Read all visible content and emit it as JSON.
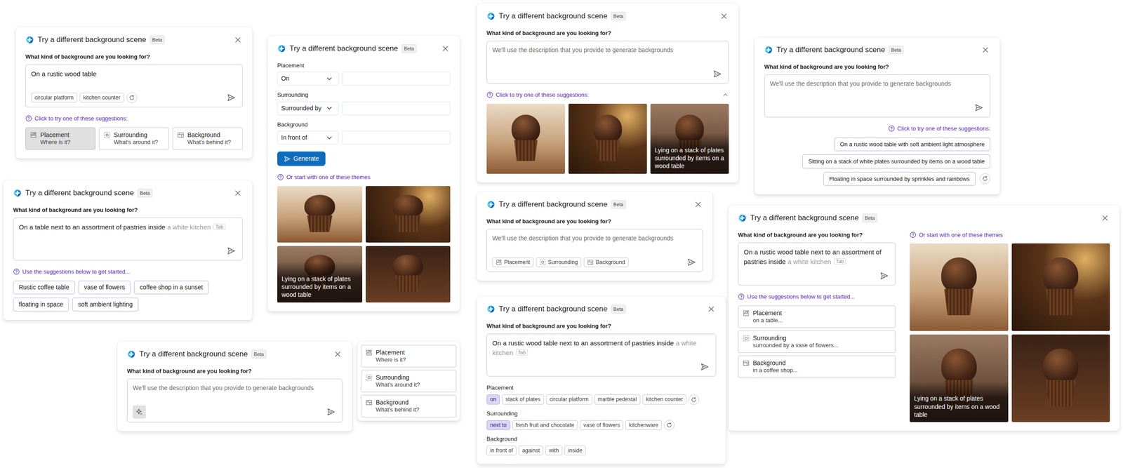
{
  "panels": [
    {
      "kind": "dialog",
      "title": "Try a different background scene",
      "badge": "Beta",
      "question": "What kind of background are you looking for?",
      "columns": [
        [
          {
            "kind": "input",
            "value": "On a rustic wood table",
            "chips": [
              {
                "kind": "chip",
                "label": "circular platform"
              },
              {
                "kind": "chip",
                "label": "kitchen counter"
              },
              {
                "kind": "refresh"
              }
            ]
          },
          {
            "kind": "hint",
            "text": "Click to try one of these suggestions:"
          },
          {
            "kind": "cards",
            "items": [
              {
                "label": "Placement",
                "sub": "Where is it?",
                "selected": true
              },
              {
                "label": "Surrounding",
                "sub": "What's around it?",
                "selected": false
              },
              {
                "label": "Background",
                "sub": "What's behind it?",
                "selected": false
              }
            ]
          }
        ]
      ]
    },
    {
      "kind": "dialog",
      "title": "Try a different background scene",
      "badge": "Beta",
      "columns": [
        [
          {
            "kind": "fields",
            "items": [
              {
                "label": "Placement",
                "select": "On"
              },
              {
                "label": "Surrounding",
                "select": "Surrounded by"
              },
              {
                "label": "Background",
                "select": "In front of"
              }
            ]
          },
          {
            "kind": "button",
            "label": "Generate"
          },
          {
            "kind": "hint",
            "text": "Or start with one of these themes"
          },
          {
            "kind": "grid",
            "items": [
              {},
              {},
              {
                "caption": "Lying on a stack of plates surrounded by items on a wood table"
              },
              {}
            ]
          }
        ]
      ]
    },
    {
      "kind": "dialog",
      "title": "Try a different background scene",
      "badge": "Beta",
      "question": "What kind of background are you looking for?",
      "columns": [
        [
          {
            "kind": "input",
            "placeholder": "We'll use the description that you provide to generate backgrounds"
          },
          {
            "kind": "hint",
            "text": "Click to try one of these suggestions:",
            "expanded": true
          },
          {
            "kind": "row",
            "items": [
              {},
              {},
              {
                "caption": "Lying on a stack of plates surrounded by items on a wood table"
              }
            ]
          }
        ]
      ]
    },
    {
      "kind": "dialog",
      "title": "Try a different background scene",
      "badge": "Beta",
      "question": "What kind of background are you looking for?",
      "columns": [
        [
          {
            "kind": "input",
            "placeholder": "We'll use the description that you provide to generate backgrounds"
          },
          {
            "kind": "hint-end",
            "text": "Click to try one of these suggestions:"
          },
          {
            "kind": "suggestions",
            "items": [
              {
                "kind": "chip",
                "label": "On a rustic wood table with soft ambient light atmosphere"
              },
              {
                "kind": "chip",
                "label": "Sitting on a stack of white plates surrounded by items on a wood table"
              },
              {
                "kind": "chip",
                "label": "Floating in space surrounded by sprinkles and rainbows"
              },
              {
                "kind": "refresh"
              }
            ]
          }
        ]
      ]
    },
    {
      "kind": "dialog",
      "title": "Try a different background scene",
      "badge": "Beta",
      "question": "What kind of background are you looking for?",
      "columns": [
        [
          {
            "kind": "input",
            "value": "On a table next to an assortment of pastries inside",
            "ghost": "a white kitchen",
            "key": "Tab"
          },
          {
            "kind": "hint",
            "text": "Use the suggestions below to get started..."
          },
          {
            "kind": "chips",
            "items": [
              {
                "kind": "chip",
                "label": "Rustic coffee table"
              },
              {
                "kind": "chip",
                "label": "vase of flowers"
              },
              {
                "kind": "chip",
                "label": "coffee shop in a sunset"
              },
              {
                "kind": "chip",
                "label": "floating in space"
              },
              {
                "kind": "chip",
                "label": "soft ambient lighting"
              }
            ]
          }
        ]
      ]
    },
    {
      "kind": "dialog",
      "title": "Try a different background scene",
      "badge": "Beta",
      "question": "What kind of background are you looking for?",
      "columns": [
        [
          {
            "kind": "input",
            "placeholder": "We'll use the description that you provide to generate backgrounds",
            "chips": [
              {
                "kind": "icon-chip",
                "label": "Placement"
              },
              {
                "kind": "icon-chip",
                "label": "Surrounding"
              },
              {
                "kind": "icon-chip",
                "label": "Background"
              }
            ]
          }
        ]
      ]
    },
    {
      "kind": "dialog",
      "title": "Try a different background scene",
      "badge": "Beta",
      "question": "What kind of background are you looking for?",
      "columns": [
        [
          {
            "kind": "input",
            "value": "On a rustic wood table next to an assortment of pastries inside",
            "ghost": "a white kitchen",
            "key": "Tab"
          },
          {
            "kind": "groups",
            "items": [
              {
                "label": "Placement",
                "chips": [
                  {
                    "kind": "chip",
                    "label": "on",
                    "selected": true
                  },
                  {
                    "kind": "chip",
                    "label": "stack of plates",
                    "selected": false
                  },
                  {
                    "kind": "chip",
                    "label": "circular platform",
                    "selected": false
                  },
                  {
                    "kind": "chip",
                    "label": "marble pedestal",
                    "selected": false
                  },
                  {
                    "kind": "chip",
                    "label": "kitchen counter",
                    "selected": false
                  },
                  {
                    "kind": "refresh"
                  }
                ]
              },
              {
                "label": "Surrounding",
                "chips": [
                  {
                    "kind": "chip",
                    "label": "next to",
                    "selected": true
                  },
                  {
                    "kind": "chip",
                    "label": "fresh fruit and chocolate",
                    "selected": false
                  },
                  {
                    "kind": "chip",
                    "label": "vase of flowers",
                    "selected": false
                  },
                  {
                    "kind": "chip",
                    "label": "kitchenware",
                    "selected": false
                  },
                  {
                    "kind": "refresh"
                  }
                ]
              },
              {
                "label": "Background",
                "chips": [
                  {
                    "kind": "chip",
                    "label": "in front of",
                    "selected": false
                  },
                  {
                    "kind": "chip",
                    "label": "against",
                    "selected": false
                  },
                  {
                    "kind": "chip",
                    "label": "with",
                    "selected": false
                  },
                  {
                    "kind": "chip",
                    "label": "inside",
                    "selected": false
                  }
                ]
              }
            ]
          }
        ]
      ]
    },
    {
      "kind": "dialog",
      "title": "Try a different background scene",
      "badge": "Beta",
      "question": "What kind of background are you looking for?",
      "columns": [
        [
          {
            "kind": "input",
            "placeholder": "We'll use the description that you provide to generate backgrounds",
            "chips": [
              {
                "kind": "sparkle",
                "selected": true
              }
            ]
          }
        ]
      ]
    },
    {
      "kind": "menu",
      "columns": [
        [
          {
            "kind": "list",
            "items": [
              {
                "label": "Placement",
                "sub": "Where is it?"
              },
              {
                "label": "Surrounding",
                "sub": "What's around it?"
              },
              {
                "label": "Background",
                "sub": "What's behind it?"
              }
            ]
          }
        ]
      ]
    },
    {
      "kind": "dialog",
      "title": "Try a different background scene",
      "badge": "Beta",
      "question": "What kind of background are you looking for?",
      "columns": [
        [
          {
            "kind": "input",
            "value": "On a rustic wood table next to an assortment of pastries inside",
            "ghost": "a white kitchen",
            "key": "Tab"
          },
          {
            "kind": "hint",
            "text": "Use the suggestions below to get started..."
          },
          {
            "kind": "list",
            "items": [
              {
                "label": "Placement",
                "sub": "on a table..."
              },
              {
                "label": "Surrounding",
                "sub": "surrounded by a vase of flowers..."
              },
              {
                "label": "Background",
                "sub": "in a coffee shop..."
              }
            ]
          }
        ],
        [
          {
            "kind": "hint",
            "text": "Or start with one of these themes"
          },
          {
            "kind": "grid",
            "items": [
              {},
              {},
              {
                "caption": "Lying on a stack of plates surrounded by items on a wood table"
              },
              {}
            ]
          }
        ]
      ]
    }
  ]
}
